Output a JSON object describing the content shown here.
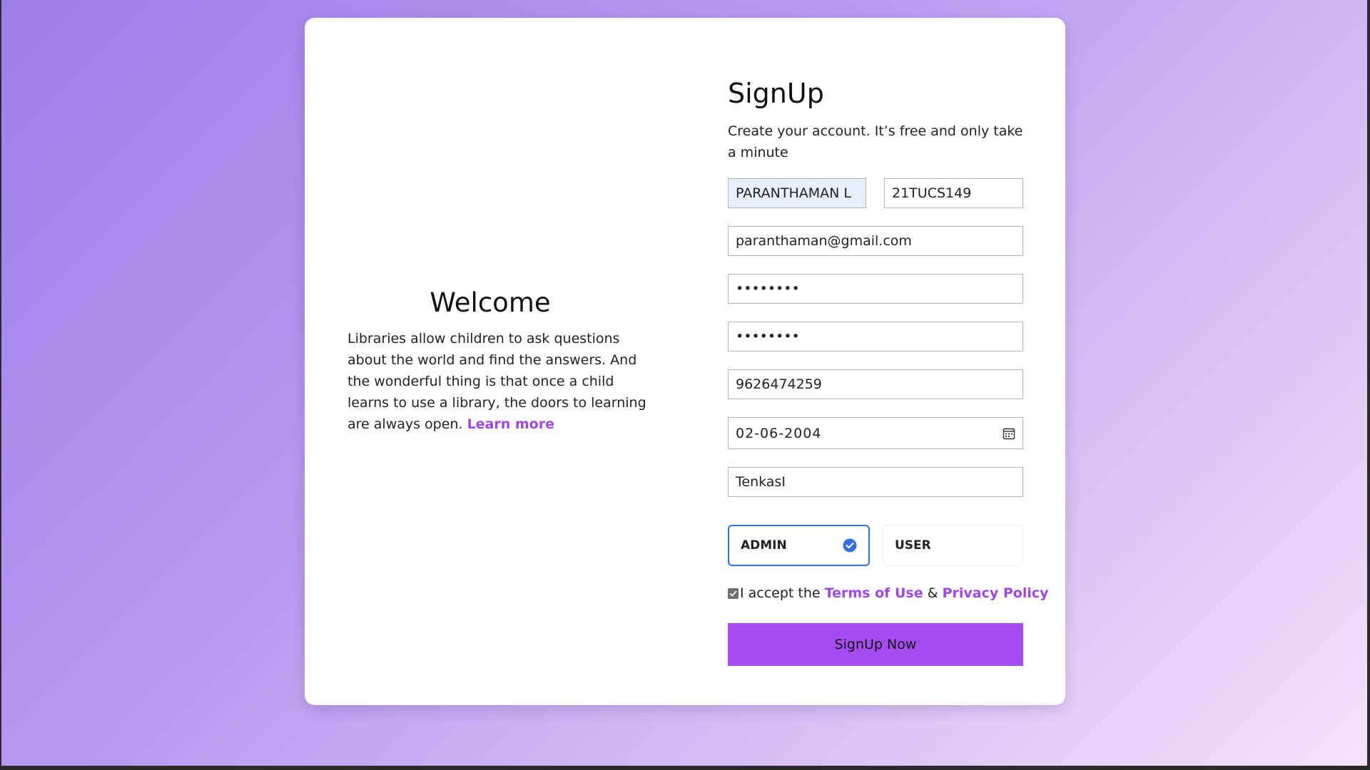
{
  "welcome": {
    "title": "Welcome",
    "text": "Libraries allow children to ask questions about the world and find the answers. And the wonderful thing is that once a child learns to use a library, the doors to learning are always open.",
    "link_label": "Learn more"
  },
  "signup": {
    "title": "SignUp",
    "subtitle": "Create your account. It’s free and only take a minute",
    "fields": {
      "name": "PARANTHAMAN L",
      "roll_no": "21TUCS149",
      "email": "paranthaman@gmail.com",
      "password": "••••••••",
      "confirm_password": "••••••••",
      "phone": "9626474259",
      "dob": "02-06-2004",
      "city": "TenkasI"
    },
    "roles": {
      "admin_label": "ADMIN",
      "user_label": "USER",
      "selected": "ADMIN"
    },
    "terms": {
      "prefix": "I accept the",
      "terms_label": "Terms of Use",
      "and": "&",
      "privacy_label": "Privacy Policy",
      "checked": true
    },
    "submit_label": "SignUp Now"
  },
  "colors": {
    "accent": "#a54cf2",
    "link": "#9f46e6",
    "selected_border": "#2f6fe0",
    "gradient_start": "#9f7eea",
    "gradient_end": "#f7e1fc"
  },
  "icons": {
    "calendar": "calendar-icon",
    "check": "check-circle-icon",
    "checkbox": "checkbox-checked-icon"
  }
}
